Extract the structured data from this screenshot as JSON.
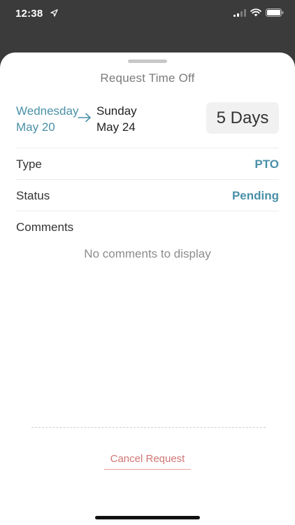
{
  "status_bar": {
    "time": "12:38"
  },
  "sheet": {
    "title": "Request Time Off",
    "date_range": {
      "start_weekday": "Wednesday",
      "start_date": "May 20",
      "end_weekday": "Sunday",
      "end_date": "May 24",
      "duration": "5 Days"
    },
    "details": {
      "type_label": "Type",
      "type_value": "PTO",
      "status_label": "Status",
      "status_value": "Pending",
      "comments_label": "Comments",
      "comments_empty": "No comments to display"
    },
    "cancel_label": "Cancel Request"
  },
  "colors": {
    "accent": "#4a90a8",
    "danger": "#d27474",
    "backdrop": "#3b3b3b"
  }
}
